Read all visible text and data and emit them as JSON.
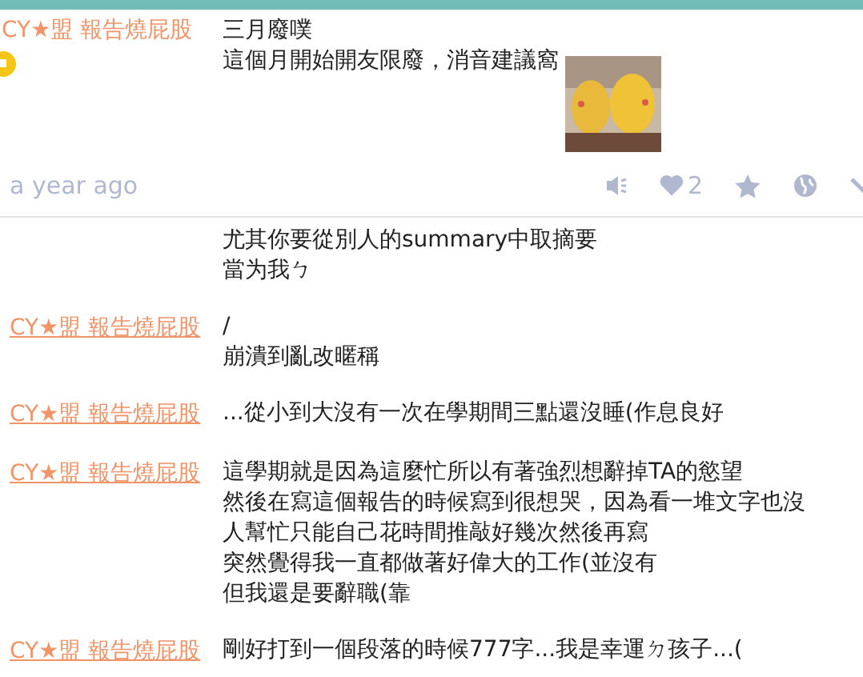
{
  "post": {
    "author": "CY★盟 報告燒屁股",
    "lines": [
      "三月廢噗",
      "這個月開始開友限廢，消音建議窩"
    ],
    "time": "a year ago",
    "likes": "2"
  },
  "replies": [
    {
      "lines": [
        "尤其你要從別人的summary中取摘要",
        "當为我ㄅ"
      ]
    },
    {
      "author": "CY★盟 報告燒屁股",
      "lines": [
        "/",
        "崩潰到亂改暱稱"
      ]
    },
    {
      "author": "CY★盟 報告燒屁股",
      "lines": [
        "...從小到大沒有一次在學期間三點還沒睡(作息良好"
      ]
    },
    {
      "author": "CY★盟 報告燒屁股",
      "lines": [
        "這學期就是因為這麼忙所以有著強烈想辭掉TA的慾望",
        "然後在寫這個報告的時候寫到很想哭，因為看一堆文字也沒",
        "人幫忙只能自己花時間推敲好幾次然後再寫",
        "突然覺得我一直都做著好偉大的工作(並沒有",
        "但我還是要辭職(靠"
      ]
    },
    {
      "author": "CY★盟 報告燒屁股",
      "lines": [
        "剛好打到一個段落的時候777字...我是幸運ㄉ孩子...("
      ]
    }
  ]
}
